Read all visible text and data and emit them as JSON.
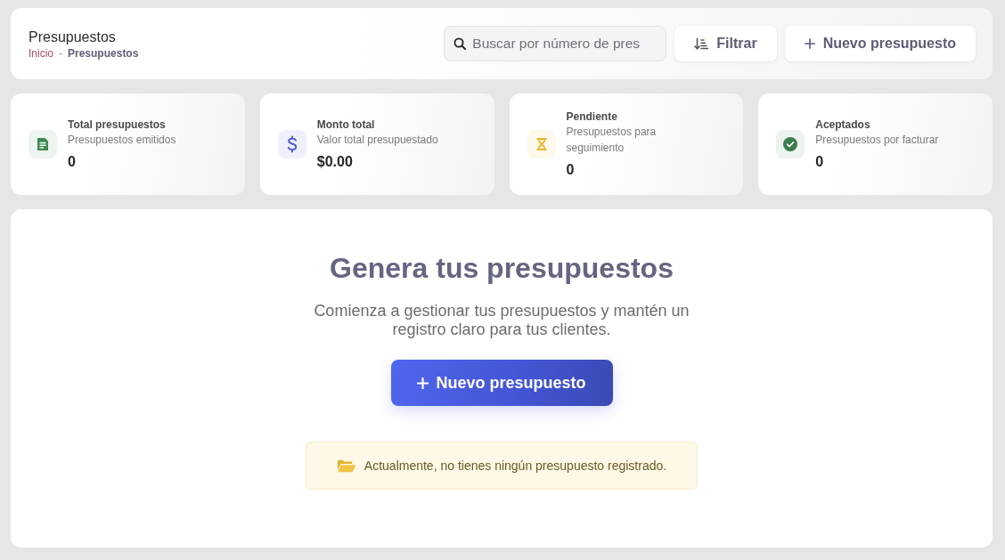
{
  "header": {
    "title": "Presupuestos",
    "breadcrumb": {
      "items": [
        "Inicio",
        "Presupuestos"
      ],
      "separator": "-"
    },
    "search": {
      "placeholder": "Buscar por número de pres"
    },
    "buttons": [
      {
        "label": "Filtrar",
        "kind": "filter"
      },
      {
        "label": "Nuevo presupuesto",
        "kind": "create"
      }
    ]
  },
  "stats": [
    {
      "kind": "total",
      "title": "Total presupuestos",
      "subtitle": "Presupuestos emitidos",
      "value": "0",
      "color": "#3d8a4f"
    },
    {
      "kind": "amount",
      "title": "Monto total",
      "subtitle": "Valor total presupuestado",
      "value": "$0.00",
      "color": "#4f5bd5"
    },
    {
      "kind": "pending",
      "title": "Pendiente",
      "subtitle": "Presupuestos para seguimiento",
      "value": "0",
      "color": "#e8b931"
    },
    {
      "kind": "accepted",
      "title": "Aceptados",
      "subtitle": "Presupuestos por facturar",
      "value": "0",
      "color": "#3b7d4f"
    }
  ],
  "empty_state": {
    "title": "Genera tus presupuestos",
    "description": "Comienza a gestionar tus presupuestos y mantén un registro claro para tus clientes.",
    "button": {
      "label": "Nuevo presupuesto"
    },
    "notice": {
      "text": "Actualmente, no tienes ningún presupuesto registrado."
    }
  }
}
